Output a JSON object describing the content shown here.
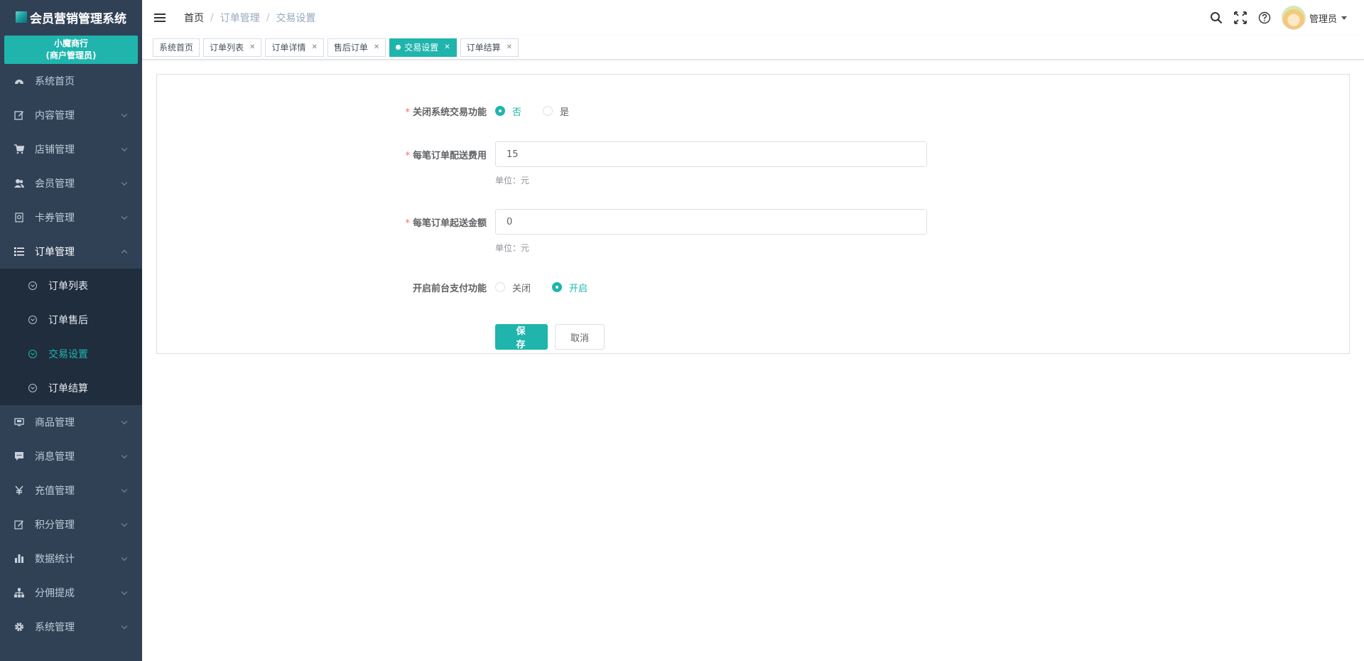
{
  "app": {
    "title": "会员营销管理系统",
    "merchant_name": "小魔商行",
    "merchant_role": "(商户管理员)"
  },
  "sidebar": {
    "items": [
      {
        "label": "系统首页",
        "icon": "dashboard-icon"
      },
      {
        "label": "内容管理",
        "icon": "edit-icon"
      },
      {
        "label": "店铺管理",
        "icon": "cart-icon"
      },
      {
        "label": "会员管理",
        "icon": "users-icon"
      },
      {
        "label": "卡券管理",
        "icon": "coupon-icon"
      },
      {
        "label": "订单管理",
        "icon": "list-icon"
      },
      {
        "label": "商品管理",
        "icon": "monitor-icon"
      },
      {
        "label": "消息管理",
        "icon": "message-icon"
      },
      {
        "label": "充值管理",
        "icon": "yen-icon"
      },
      {
        "label": "积分管理",
        "icon": "points-icon"
      },
      {
        "label": "数据统计",
        "icon": "bar-chart-icon"
      },
      {
        "label": "分佣提成",
        "icon": "org-chart-icon"
      },
      {
        "label": "系统管理",
        "icon": "gear-icon"
      }
    ],
    "order_submenu": [
      "订单列表",
      "订单售后",
      "交易设置",
      "订单结算"
    ]
  },
  "header": {
    "breadcrumb": [
      "首页",
      "订单管理",
      "交易设置"
    ],
    "separator": "/",
    "user": "管理员"
  },
  "tags": [
    {
      "label": "系统首页",
      "closable": false,
      "active": false
    },
    {
      "label": "订单列表",
      "closable": true,
      "active": false
    },
    {
      "label": "订单详情",
      "closable": true,
      "active": false
    },
    {
      "label": "售后订单",
      "closable": true,
      "active": false
    },
    {
      "label": "交易设置",
      "closable": true,
      "active": true
    },
    {
      "label": "订单结算",
      "closable": true,
      "active": false
    }
  ],
  "form": {
    "close_trade": {
      "label": "关闭系统交易功能",
      "options": [
        "否",
        "是"
      ],
      "selected": "否"
    },
    "delivery_fee": {
      "label": "每笔订单配送费用",
      "value": "15",
      "hint": "单位：元"
    },
    "min_amount": {
      "label": "每笔订单起送金额",
      "value": "0",
      "hint": "单位：元"
    },
    "front_pay": {
      "label": "开启前台支付功能",
      "options": [
        "关闭",
        "开启"
      ],
      "selected": "开启"
    },
    "save_label": "保 存",
    "cancel_label": "取消"
  },
  "colors": {
    "accent": "#1fb5ad",
    "sidebar_bg": "#304156",
    "submenu_bg": "#1f2d3d",
    "required": "#f56c6c"
  }
}
